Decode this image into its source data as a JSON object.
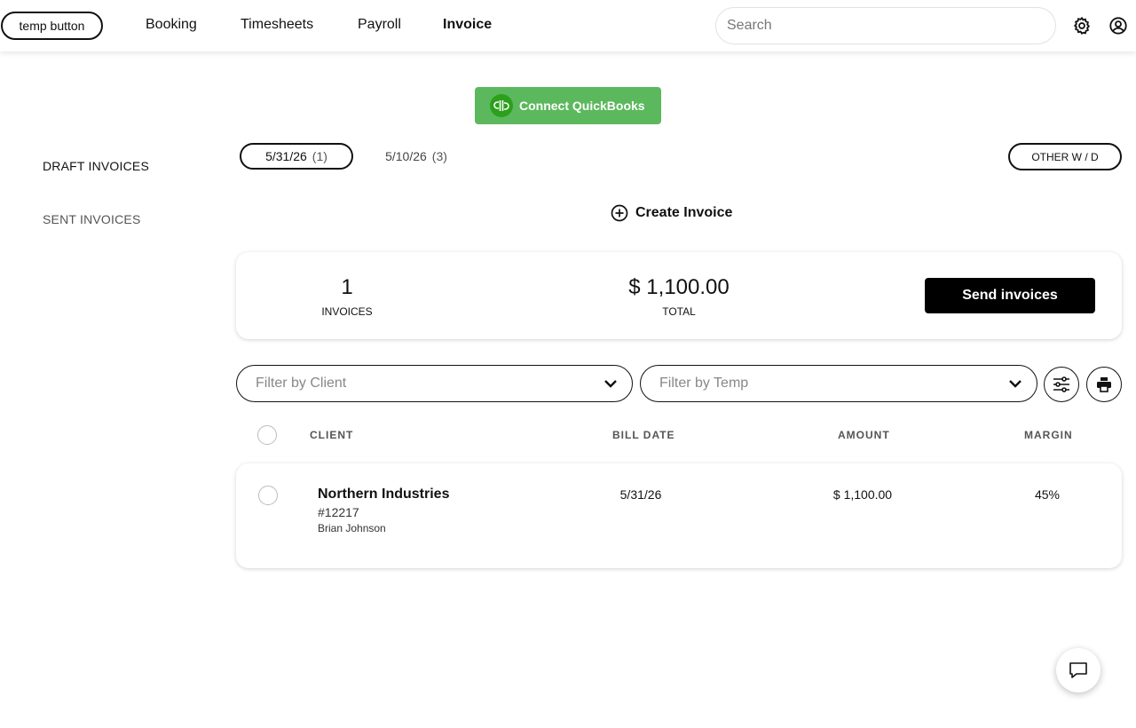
{
  "header": {
    "temp_button": "temp button",
    "nav": [
      {
        "label": "Booking",
        "active": false
      },
      {
        "label": "Timesheets",
        "active": false
      },
      {
        "label": "Payroll",
        "active": false
      },
      {
        "label": "Invoice",
        "active": true
      }
    ],
    "search_placeholder": "Search",
    "icons": [
      "gear-icon",
      "user-circle-icon"
    ]
  },
  "quickbooks": {
    "label": "Connect QuickBooks",
    "logo_text": "qb",
    "color": "#5cb85c"
  },
  "sidebar": {
    "items": [
      {
        "label": "DRAFT INVOICES",
        "active": true
      },
      {
        "label": "SENT INVOICES",
        "active": false
      }
    ]
  },
  "weeks": {
    "tabs": [
      {
        "date": "5/31/26",
        "count": "(1)",
        "active": true
      },
      {
        "date": "5/10/26",
        "count": "(3)",
        "active": false
      }
    ],
    "other_label": "OTHER W / D"
  },
  "create_label": "Create Invoice",
  "summary": {
    "invoices_count": "1",
    "invoices_label": "INVOICES",
    "total_value": "$ 1,100.00",
    "total_label": "TOTAL",
    "send_label": "Send invoices"
  },
  "filters": {
    "client_placeholder": "Filter by Client",
    "temp_placeholder": "Filter by Temp"
  },
  "table": {
    "columns": [
      "CLIENT",
      "BILL DATE",
      "AMOUNT",
      "MARGIN"
    ],
    "rows": [
      {
        "client": "Northern Industries",
        "number": "#12217",
        "temp": "Brian Johnson",
        "bill_date": "5/31/26",
        "amount": "$ 1,100.00",
        "margin": "45%"
      }
    ]
  },
  "accent": "#000000"
}
